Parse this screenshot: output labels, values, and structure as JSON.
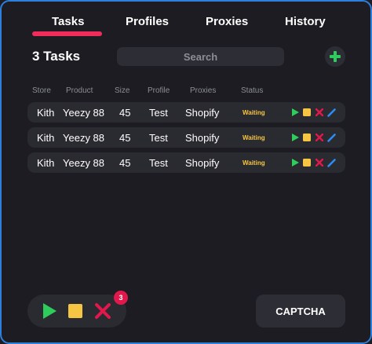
{
  "tabs": [
    {
      "label": "Tasks",
      "active": true
    },
    {
      "label": "Profiles",
      "active": false
    },
    {
      "label": "Proxies",
      "active": false
    },
    {
      "label": "History",
      "active": false
    }
  ],
  "header": {
    "task_count": "3 Tasks",
    "search_placeholder": "Search",
    "add_icon": "plus-icon"
  },
  "table": {
    "columns": [
      "Store",
      "Product",
      "Size",
      "Profile",
      "Proxies",
      "Status"
    ],
    "rows": [
      {
        "store": "Kith",
        "product": "Yeezy 88",
        "size": "45",
        "profile": "Test",
        "proxies": "Shopify",
        "status": "Waiting"
      },
      {
        "store": "Kith",
        "product": "Yeezy 88",
        "size": "45",
        "profile": "Test",
        "proxies": "Shopify",
        "status": "Waiting"
      },
      {
        "store": "Kith",
        "product": "Yeezy 88",
        "size": "45",
        "profile": "Test",
        "proxies": "Shopify",
        "status": "Waiting"
      }
    ],
    "row_actions": [
      "play-icon",
      "stop-icon",
      "delete-icon",
      "edit-icon"
    ]
  },
  "footer": {
    "bulk_actions": [
      "play-icon",
      "stop-icon",
      "delete-icon"
    ],
    "badge_count": "3",
    "captcha_label": "CAPTCHA"
  },
  "colors": {
    "background": "#1c1c22",
    "accent": "#f02d5a",
    "play": "#2ecc5b",
    "stop": "#f6c543",
    "delete": "#e0184c",
    "edit": "#2d8cf0",
    "status_waiting": "#f6c543"
  }
}
